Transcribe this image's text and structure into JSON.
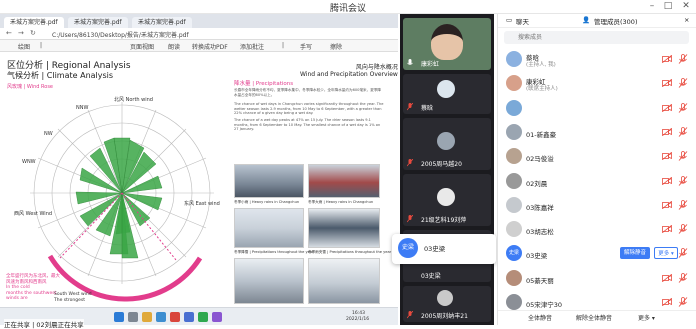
{
  "window": {
    "title": "腾讯会议"
  },
  "browser": {
    "tabs": [
      "禾城方案完善.pdf",
      "禾城方案完善.pdf",
      "禾城方案完善.pdf"
    ],
    "address": "C:/Users/86130/Desktop/报告/禾城方案完善.pdf",
    "tools": [
      "绘图",
      "|",
      "页面视图",
      "朗读",
      "转换成功PDF",
      "添加批注",
      "|",
      "手写",
      "擦除"
    ]
  },
  "document": {
    "section_cn": "区位分析 | Regional Analysis",
    "subsection": "气候分析 | Climate Analysis",
    "rose_label": "风玫瑰 | Wind Rose",
    "wind_precip_title": "风向与降水概况\nWind and Precipitation Overview",
    "precip_label": "降水量 | Precipitations",
    "directions": {
      "n": "北风\nNorth\nwind",
      "nnw": "NNW",
      "nw": "NW",
      "wnw": "WNW",
      "w": "西风\nWest\nWind",
      "e": "东风\nEast\nwind",
      "s": "South\nWest\nwind"
    },
    "note": "全年盛行风为东北风，最大\n风速为南风和西南风\nIn the cold\nmonths the southwest\nwinds are",
    "south_label": "South West wind\nThe strongest",
    "captions": [
      "冬季小雨 | Heavy rains in Changchun",
      "冬季大雨 | Heavy rains in Changchun",
      "冬季降雪 | Precipitations throughout the year",
      "冬季雨夹雪 | Precipitations throughout the year"
    ],
    "paragraph1": "长春市全年降雨分布不均，夏季降水集中，冬季降水较少。全年降水量约为600毫米，夏季降水量占全年的60%以上。",
    "paragraph2": "The chance of wet days in Changchun varies significantly throughout the year. The wetter season lasts 2.9 months, from 10 May to 6 September, with a greater than 22% chance of a given day being a wet day.",
    "paragraph3": "The chance of a wet day peaks at 47% on 15 July. The drier season lasts 9.1 months, from 6 September to 10 May. The smallest chance of a wet day is 1% on 27 January."
  },
  "taskbar": {
    "time": "16:43",
    "date": "2022/1/16"
  },
  "sharer": "正在共享 | 02刘晨正在共享",
  "videos": [
    {
      "name": "康彩虹",
      "kind": "photo"
    },
    {
      "name": "蔡晗",
      "kind": "avatar"
    },
    {
      "name": "2005周马越20",
      "kind": "avatar"
    },
    {
      "name": "21级艺科19刘萍",
      "kind": "avatar"
    },
    {
      "name": "03史梁",
      "kind": "initials"
    },
    {
      "name": "2005周刘纳丰21",
      "kind": "avatar"
    }
  ],
  "popup": {
    "initials": "史梁",
    "name": "03史梁"
  },
  "panel": {
    "chat_tab": "聊天",
    "members_tab": "管理成员(300)",
    "search_placeholder": "搜索成员",
    "members": [
      {
        "name": "蔡晗",
        "role": "(主持人, 我)",
        "avatar_color": "#8bb1e0"
      },
      {
        "name": "康彩虹",
        "role": "(联席主持人)",
        "avatar_color": "#d7a08a"
      },
      {
        "name": "",
        "role": "",
        "avatar_color": "#7aa9d8"
      },
      {
        "name": "01-新鑫豪",
        "role": "",
        "avatar_color": "#9aa5b1"
      },
      {
        "name": "02马俊溢",
        "role": "",
        "avatar_color": "#b7a290"
      },
      {
        "name": "02刘晨",
        "role": "",
        "avatar_color": "#999999"
      },
      {
        "name": "03陈嘉祥",
        "role": "",
        "avatar_color": "#c5c9ce"
      },
      {
        "name": "03胡志松",
        "role": "",
        "avatar_color": "#cfcfcf"
      },
      {
        "name": "03史梁",
        "role": "",
        "avatar_color": "#3d7cf5",
        "initials": "史梁"
      },
      {
        "name": "05綦天丽",
        "role": "",
        "avatar_color": "#b58d79"
      },
      {
        "name": "05宋津宁30",
        "role": "",
        "avatar_color": "#8b8f96"
      }
    ],
    "unmute_label": "解除静音",
    "more_label": "更多 ▾",
    "footer": {
      "mute_all": "全体静音",
      "unmute_all": "解除全体静音",
      "more": "更多 ▾"
    }
  },
  "colors": {
    "accent": "#3d7cf5",
    "rose_pink": "#e23c8c",
    "rose_green": "#3aa645",
    "mute_red": "#e84a3e"
  }
}
